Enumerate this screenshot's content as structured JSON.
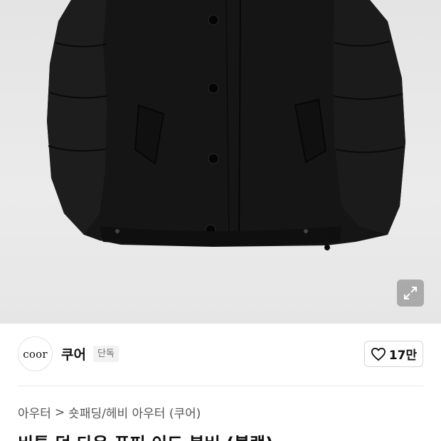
{
  "product_image": {
    "alt_icon": "black-padded-jacket-image"
  },
  "expand_button": {
    "icon": "expand-arrows-icon"
  },
  "brand": {
    "logo_text": "coor",
    "name": "쿠어",
    "badge": "단독"
  },
  "like": {
    "icon": "heart-outline-icon",
    "count": "17만"
  },
  "breadcrumb": {
    "level1": "아우터",
    "separator": ">",
    "level2": "숏패딩/헤비 아우터 (쿠어)"
  },
  "product": {
    "title": "비튼 덕 다운 푸퍼 이드 봄버 (블랙)"
  },
  "colors": {
    "hero_bg": "#e8e8e8",
    "jacket": "#141414",
    "badge_bg": "#f2f2f2"
  }
}
